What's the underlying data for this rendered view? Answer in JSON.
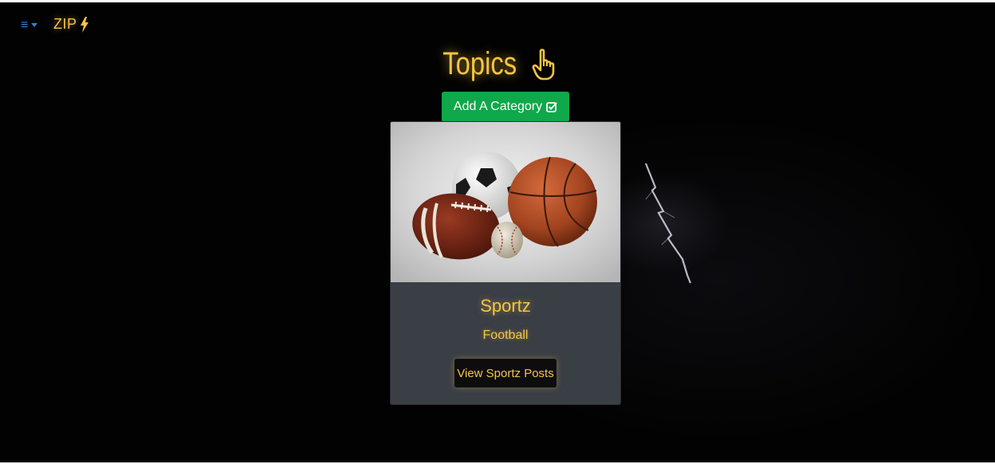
{
  "navbar": {
    "menu_icon": "hamburger-icon",
    "menu_glyph": "≡",
    "brand_label": "ZIP",
    "brand_icon": "lightning-bolt-icon"
  },
  "page": {
    "heading": "Topics",
    "heading_icon": "pointing-hand-icon"
  },
  "actions": {
    "add_category_label": "Add A Category",
    "add_category_icon": "check-square-icon"
  },
  "cards": [
    {
      "image": "sports-balls-image",
      "title": "Sportz",
      "subtitle": "Football",
      "button_label": "View Sportz Posts"
    }
  ],
  "colors": {
    "accent": "#f5c542",
    "add_button": "#0fa84a",
    "nav_toggle": "#2f7fe0",
    "card_bg": "#3a3e45",
    "background": "#020202"
  }
}
